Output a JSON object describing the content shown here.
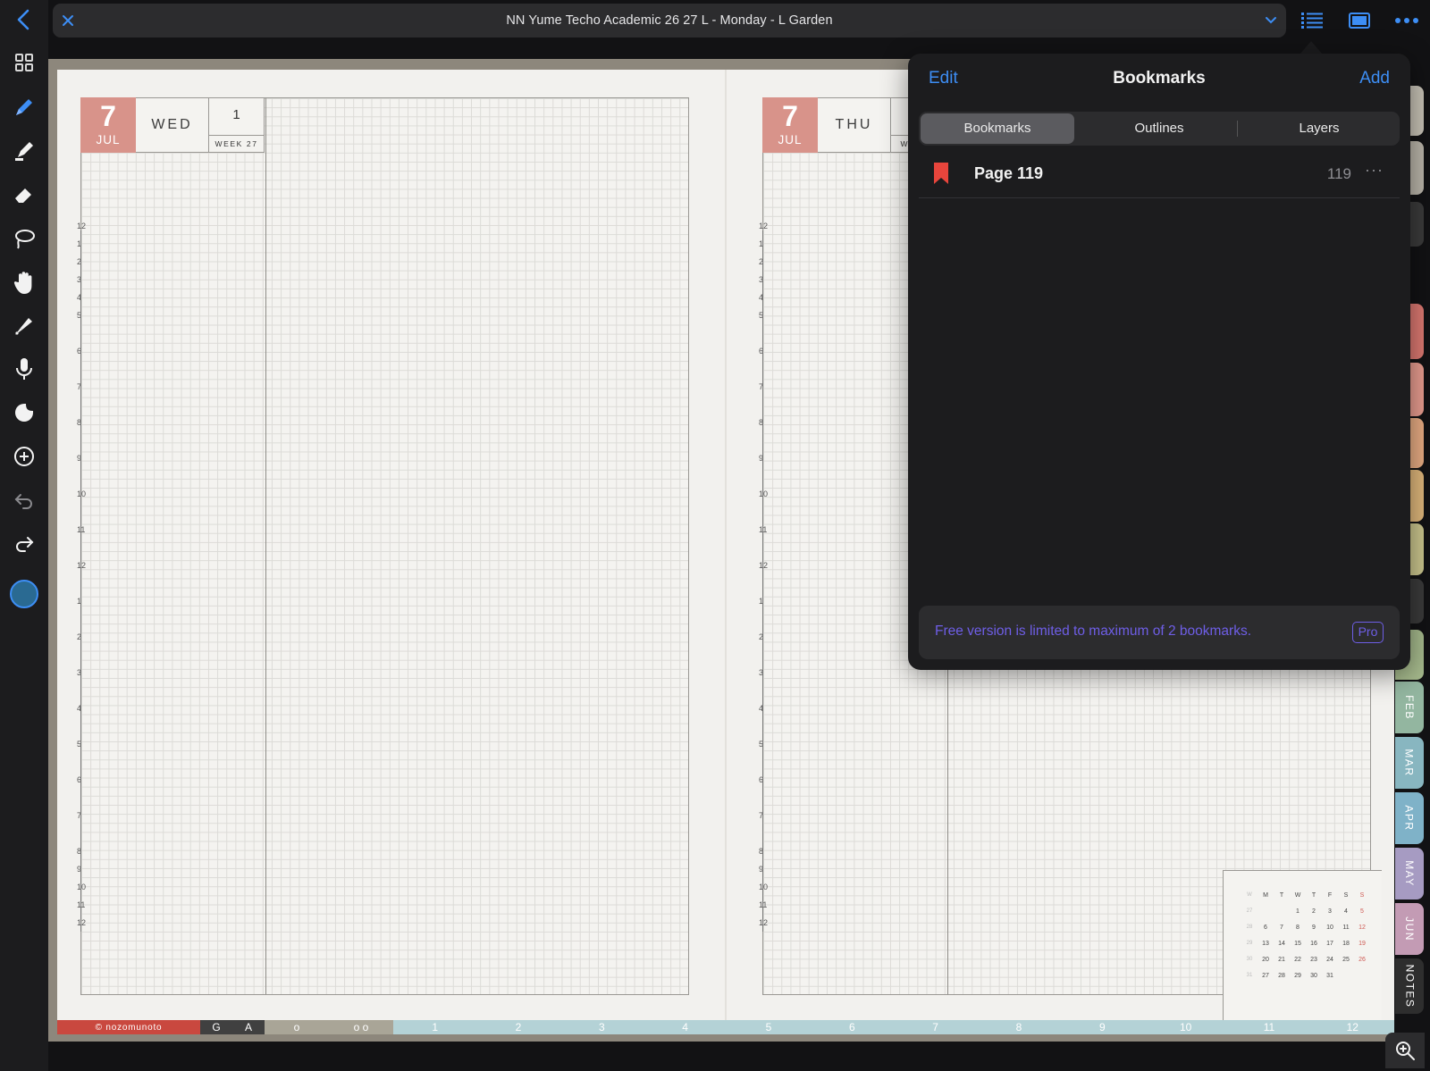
{
  "topbar": {
    "title": "NN Yume Techo Academic 26 27 L - Monday - L Garden",
    "back_icon": "chevron-left-icon",
    "close_icon": "close-icon",
    "dropdown_icon": "chevron-down-icon",
    "list_icon": "list-icon",
    "pages_icon": "single-page-icon",
    "more_icon": "ellipsis-icon"
  },
  "toolbar": {
    "tools": [
      "grid-icon",
      "pen-icon",
      "highlighter-icon",
      "eraser-icon",
      "lasso-icon",
      "hand-icon",
      "laser-pointer-icon",
      "microphone-icon",
      "sticker-icon",
      "add-circle-icon",
      "undo-icon",
      "redo-icon",
      "color-swatch"
    ],
    "active_tool": "pen-icon",
    "active_color": "#2a6a92"
  },
  "left_page": {
    "day": "7",
    "month": "JUL",
    "dow": "WED",
    "week_num": "1",
    "week_label": "WEEK 27"
  },
  "right_page": {
    "day": "7",
    "month": "JUL",
    "dow": "THU",
    "week_label_partial": "W"
  },
  "hour_labels": [
    "12",
    "1",
    "2",
    "3",
    "4",
    "5",
    "6",
    "7",
    "8",
    "9",
    "10",
    "11",
    "12",
    "1",
    "2",
    "3",
    "4",
    "5",
    "6",
    "7",
    "8",
    "9",
    "10",
    "11",
    "12"
  ],
  "mini_calendar": {
    "headers": [
      "W",
      "M",
      "T",
      "W",
      "T",
      "F",
      "S",
      "S"
    ],
    "rows": [
      [
        "27",
        "",
        "",
        "1",
        "2",
        "3",
        "4",
        "5"
      ],
      [
        "28",
        "6",
        "7",
        "8",
        "9",
        "10",
        "11",
        "12"
      ],
      [
        "29",
        "13",
        "14",
        "15",
        "16",
        "17",
        "18",
        "19"
      ],
      [
        "30",
        "20",
        "21",
        "22",
        "23",
        "24",
        "25",
        "26"
      ],
      [
        "31",
        "27",
        "28",
        "29",
        "30",
        "31",
        "",
        ""
      ]
    ]
  },
  "bottom_strip": {
    "brand": "© nozomunoto",
    "letters": [
      "G",
      "A"
    ],
    "circles": [
      "o",
      "o o"
    ],
    "months": [
      "1",
      "2",
      "3",
      "4",
      "5",
      "6",
      "7",
      "8",
      "9",
      "10",
      "11",
      "12"
    ]
  },
  "month_tabs": [
    "FEB",
    "MAR",
    "APR",
    "MAY",
    "JUN",
    "NOTES"
  ],
  "bookmarks_panel": {
    "edit_label": "Edit",
    "title": "Bookmarks",
    "add_label": "Add",
    "tabs": [
      "Bookmarks",
      "Outlines",
      "Layers"
    ],
    "active_tab": "Bookmarks",
    "items": [
      {
        "label": "Page 119",
        "page": "119",
        "icon": "bookmark-icon",
        "more": "···"
      }
    ],
    "notice": "Free version is limited to maximum of 2 bookmarks.",
    "pro_badge": "Pro"
  },
  "zoom_icon": "zoom-icon",
  "colors": {
    "accent_blue": "#3d8ef5",
    "bookmark_red": "#e8453c",
    "notice_purple": "#6e5ee6",
    "date_block": "#d8938a"
  }
}
